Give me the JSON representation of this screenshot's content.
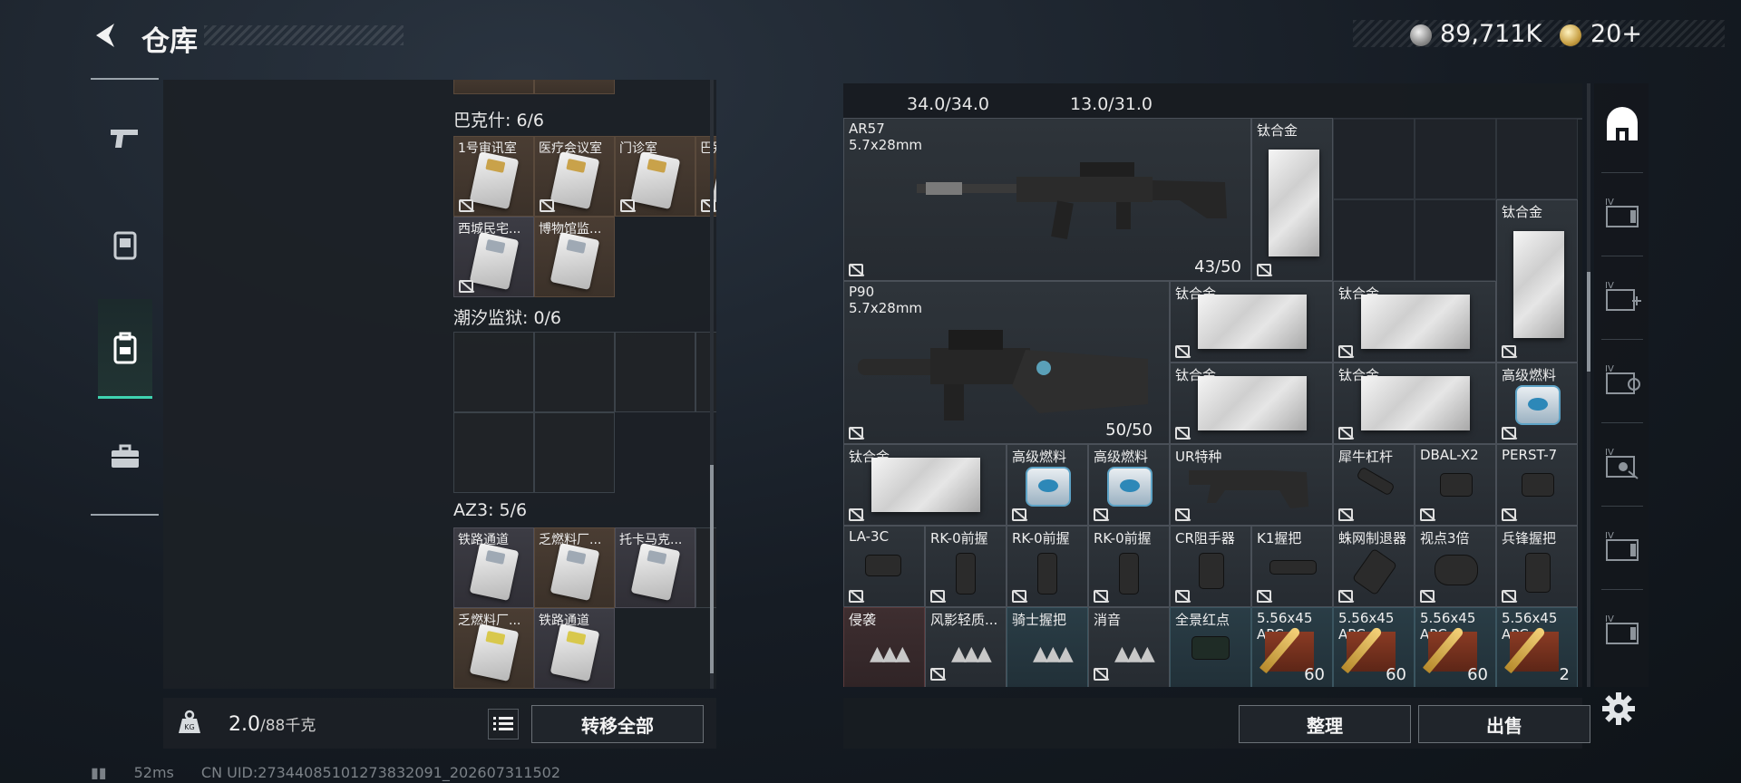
{
  "header": {
    "title": "仓库",
    "currencies": [
      {
        "icon": "silver-coin-icon",
        "value": "89,711K"
      },
      {
        "icon": "gold-coin-icon",
        "value": "20+"
      }
    ]
  },
  "left_nav": {
    "items": [
      {
        "icon": "pistol-icon",
        "active": false
      },
      {
        "icon": "keycard-icon",
        "active": false
      },
      {
        "icon": "backpack-icon",
        "active": true
      },
      {
        "icon": "briefcase-icon",
        "active": false
      }
    ]
  },
  "stash": {
    "sections": [
      {
        "title": "巴克什: 6/6",
        "cards": [
          {
            "label": "1号审讯室"
          },
          {
            "label": "医疗会议室"
          },
          {
            "label": "门诊室"
          },
          {
            "label": "巴别塔供..."
          },
          {
            "label": "西城民宅..."
          },
          {
            "label": "博物馆监..."
          }
        ]
      },
      {
        "title": "潮汐监狱: 0/6",
        "cards": []
      },
      {
        "title": "AZ3: 5/6",
        "cards": [
          {
            "label": "铁路通道"
          },
          {
            "label": "乏燃料厂..."
          },
          {
            "label": "托卡马克..."
          },
          {
            "label": "乏燃料厂..."
          },
          {
            "label": "铁路通道"
          }
        ]
      }
    ]
  },
  "left_footer": {
    "weight_current": "2.0",
    "weight_max": "/88千克",
    "weight_icon": "KG",
    "transfer_all_label": "转移全部"
  },
  "status": {
    "ping": "52ms",
    "uid": "CN UID:2734408510127383209​1_202607311502"
  },
  "inventory": {
    "ammo_stats": [
      "34.0/34.0",
      "13.0/31.0"
    ],
    "items": [
      {
        "name": "AR57",
        "sub": "5.7x28mm",
        "count": "43/50"
      },
      {
        "name": "钛合金",
        "count": ""
      },
      {
        "name": "钛合金",
        "count": ""
      },
      {
        "name": "P90",
        "sub": "5.7x28mm",
        "count": "50/50"
      },
      {
        "name": "钛合金",
        "count": ""
      },
      {
        "name": "钛合金",
        "count": ""
      },
      {
        "name": "钛合金",
        "count": ""
      },
      {
        "name": "钛合金",
        "count": ""
      },
      {
        "name": "高级燃料",
        "count": ""
      },
      {
        "name": "钛合金",
        "count": ""
      },
      {
        "name": "高级燃料",
        "count": ""
      },
      {
        "name": "高级燃料",
        "count": ""
      },
      {
        "name": "UR特种",
        "count": ""
      },
      {
        "name": "犀牛杠杆",
        "count": ""
      },
      {
        "name": "DBAL-X2",
        "count": ""
      },
      {
        "name": "PERST-7",
        "count": ""
      },
      {
        "name": "LA-3C",
        "count": ""
      },
      {
        "name": "RK-0前握",
        "count": ""
      },
      {
        "name": "RK-0前握",
        "count": ""
      },
      {
        "name": "RK-0前握",
        "count": ""
      },
      {
        "name": "CR阻手器",
        "count": ""
      },
      {
        "name": "K1握把",
        "count": ""
      },
      {
        "name": "蛛网制退器",
        "count": ""
      },
      {
        "name": "视点3倍",
        "count": ""
      },
      {
        "name": "兵锋握把",
        "count": ""
      },
      {
        "name": "侵袭",
        "count": ""
      },
      {
        "name": "风影轻质...",
        "count": ""
      },
      {
        "name": "骑士握把",
        "count": ""
      },
      {
        "name": "消音",
        "count": ""
      },
      {
        "name": "全景红点",
        "count": ""
      },
      {
        "name": "5.56x45",
        "sub": "APC",
        "count": "60"
      },
      {
        "name": "5.56x45",
        "sub": "APC",
        "count": "60"
      },
      {
        "name": "5.56x45",
        "sub": "APC",
        "count": "60"
      },
      {
        "name": "5.56x45",
        "sub": "APC",
        "count": "2"
      }
    ]
  },
  "right_footer": {
    "sort_label": "整理",
    "sell_label": "出售"
  },
  "dock": {
    "items": [
      {
        "icon": "safehouse-icon"
      },
      {
        "icon": "storage-iv-icon"
      },
      {
        "icon": "storage-iv-add-icon"
      },
      {
        "icon": "storage-iv-swap-icon"
      },
      {
        "icon": "storage-iv-lock-icon"
      },
      {
        "icon": "storage-iv-folder-icon"
      },
      {
        "icon": "storage-iv-extra-icon"
      }
    ],
    "settings_icon": "gear-icon"
  }
}
